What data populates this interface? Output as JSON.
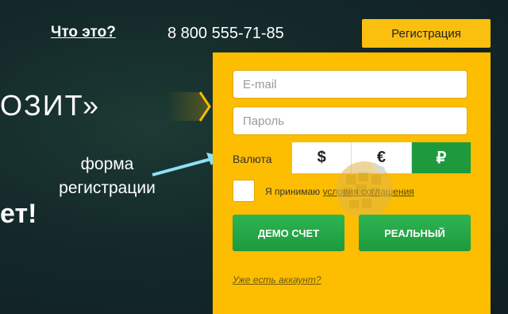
{
  "header": {
    "what_link": "Что это?",
    "phone": "8 800 555-71-85",
    "register_button": "Регистрация"
  },
  "hero": {
    "line1": "ОЗИТ»",
    "line2": "ет!"
  },
  "annotation": {
    "line1": "форма",
    "line2": "регистрации"
  },
  "form": {
    "email_placeholder": "E-mail",
    "password_placeholder": "Пароль",
    "currency_label": "Валюта",
    "currencies": [
      "$",
      "€",
      "₽"
    ],
    "selected_currency": "₽",
    "agree_text": "Я принимаю ",
    "agree_link": "условия соглашения",
    "demo_button": "ДЕМО СЧЕТ",
    "real_button": "РЕАЛЬНЫЙ",
    "have_account": "Уже есть аккаунт?"
  },
  "colors": {
    "panel": "#fdbd00",
    "accent_green": "#1e9a3c",
    "background": "#14292a"
  }
}
